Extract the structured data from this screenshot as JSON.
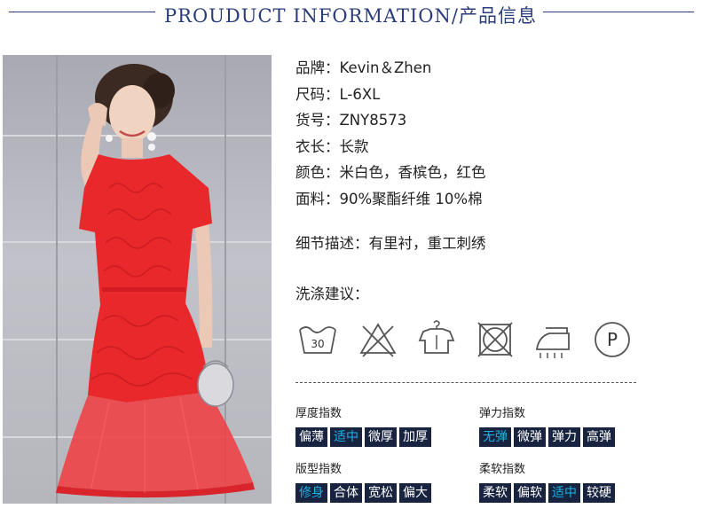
{
  "header": {
    "title": "PROUDUCT INFORMATION/产品信息"
  },
  "photo": {
    "alt": "red lace dress model photo"
  },
  "specs": [
    {
      "key": "品牌：",
      "value": "Kevin＆Zhen"
    },
    {
      "key": "尺码：",
      "value": "L-6XL"
    },
    {
      "key": "货号：",
      "value": "ZNY8573"
    },
    {
      "key": "衣长：",
      "value": "长款"
    },
    {
      "key": "颜色：",
      "value": "米白色，香槟色，红色"
    },
    {
      "key": "面料：",
      "value": "90%聚酯纤维 10%棉"
    }
  ],
  "detail": {
    "text": "细节描述：有里衬，重工刺绣"
  },
  "care": {
    "title": "洗涤建议：",
    "wash_temp": "30",
    "dryclean_letter": "P",
    "icons": [
      "wash-30-icon",
      "no-bleach-icon",
      "hang-dry-icon",
      "no-tumble-dry-icon",
      "iron-icon",
      "dryclean-p-icon"
    ]
  },
  "indexes": {
    "thickness": {
      "label": "厚度指数",
      "options": [
        "偏薄",
        "适中",
        "微厚",
        "加厚"
      ],
      "active": 1
    },
    "elasticity": {
      "label": "弹力指数",
      "options": [
        "无弹",
        "微弹",
        "弹力",
        "高弹"
      ],
      "active": 0
    },
    "fit": {
      "label": "版型指数",
      "options": [
        "修身",
        "合体",
        "宽松",
        "偏大"
      ],
      "active": 0
    },
    "softness": {
      "label": "柔软指数",
      "options": [
        "柔软",
        "偏软",
        "适中",
        "较硬"
      ],
      "active": 2
    }
  },
  "colors": {
    "navy": "#17233f",
    "accent": "#19b3e6",
    "dress": "#e8282b",
    "title": "#2a3d7a"
  }
}
